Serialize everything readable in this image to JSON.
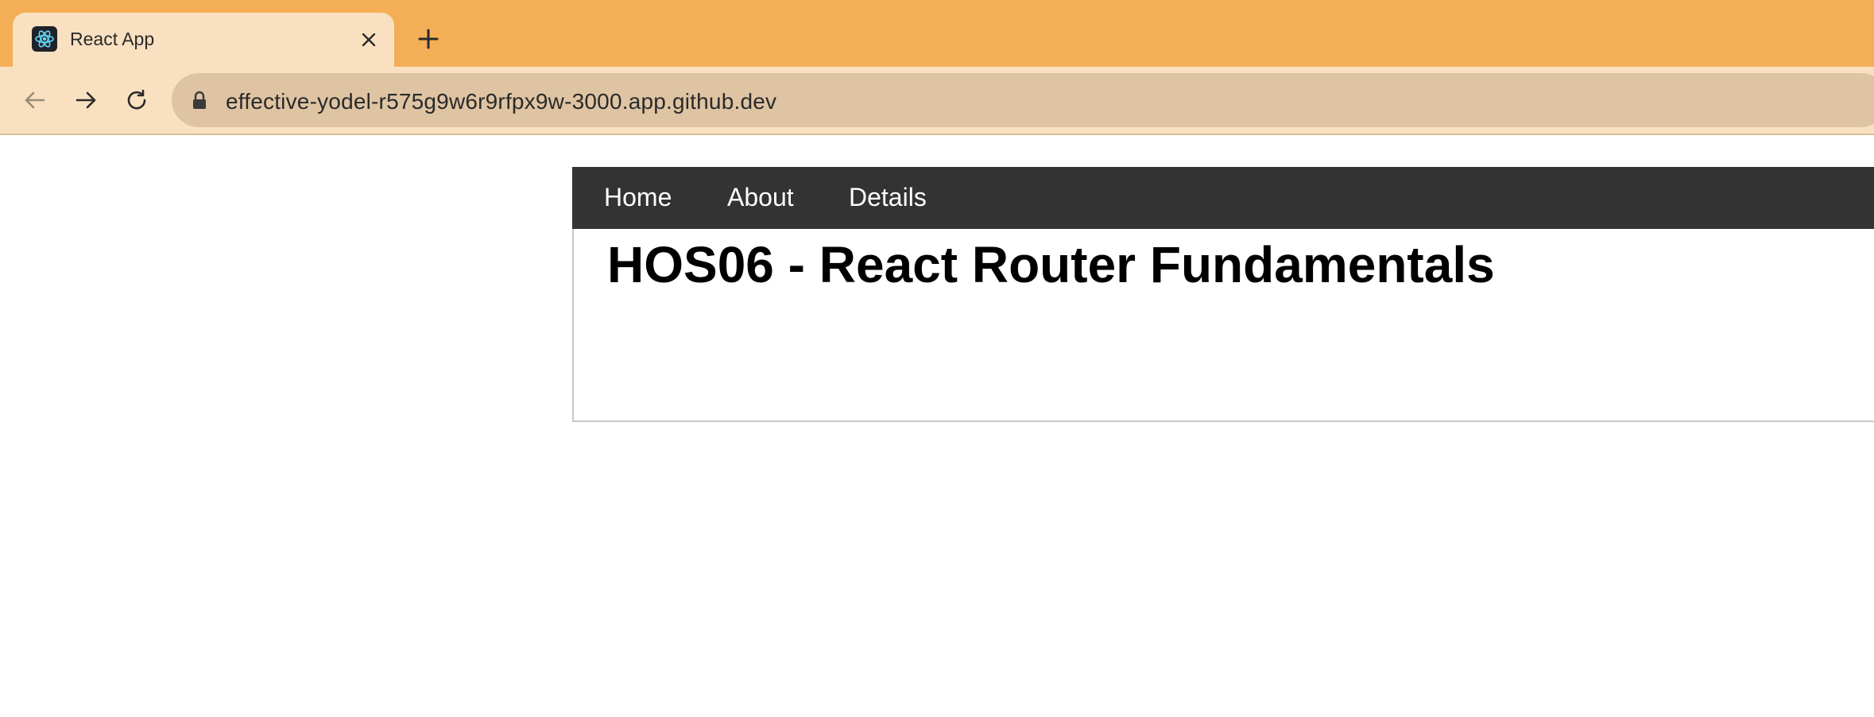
{
  "browser": {
    "tab": {
      "title": "React App",
      "favicon": "react-logo-icon",
      "close_icon": "close-icon"
    },
    "new_tab_icon": "plus-icon",
    "toolbar": {
      "back_icon": "arrow-left-icon",
      "forward_icon": "arrow-right-icon",
      "reload_icon": "reload-icon",
      "lock_icon": "lock-icon",
      "url": "effective-yodel-r575g9w6r9rfpx9w-3000.app.github.dev"
    },
    "colors": {
      "tabstrip": "#f4ae56",
      "active_tab": "#f9e0c1",
      "omnibox": "#dfc4a3"
    }
  },
  "app": {
    "nav": {
      "links": [
        "Home",
        "About",
        "Details"
      ]
    },
    "heading": "HOS06 - React Router Fundamentals",
    "colors": {
      "navbar": "#333333",
      "nav_text": "#ffffff"
    }
  }
}
